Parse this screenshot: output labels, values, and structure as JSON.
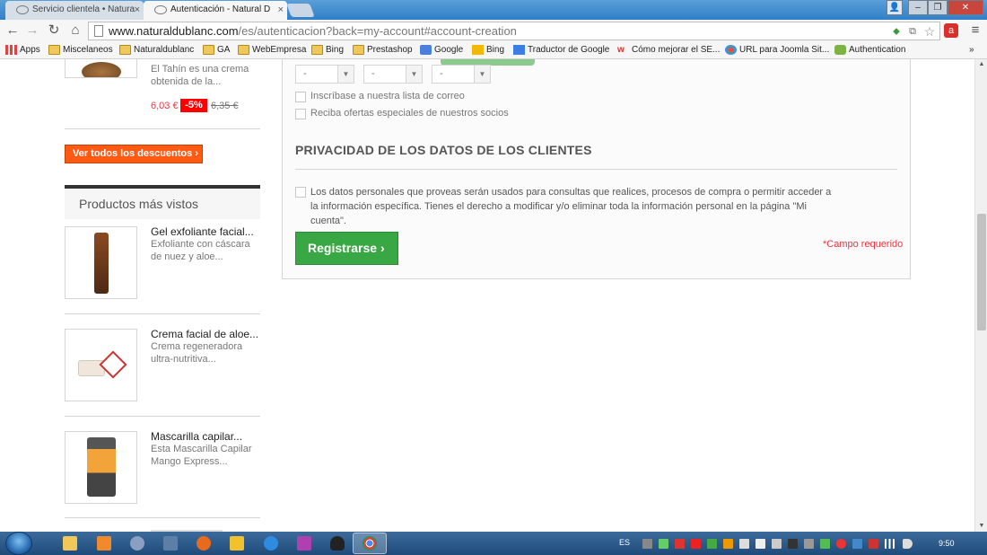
{
  "browser": {
    "tabs": [
      {
        "title": "Servicio clientela • Natura",
        "active": false
      },
      {
        "title": "Autenticación - Natural D",
        "active": true
      }
    ],
    "url_host": "www.naturaldublanc.com",
    "url_path": "/es/autenticacion?back=my-account#account-creation",
    "bookmarks": [
      {
        "label": "Apps",
        "icon": "apps-grid-icon"
      },
      {
        "label": "Miscelaneos",
        "icon": "folder-icon"
      },
      {
        "label": "Naturaldublanc",
        "icon": "folder-icon"
      },
      {
        "label": "GA",
        "icon": "folder-icon"
      },
      {
        "label": "WebEmpresa",
        "icon": "folder-icon"
      },
      {
        "label": "Bing",
        "icon": "folder-icon"
      },
      {
        "label": "Prestashop",
        "icon": "folder-icon"
      },
      {
        "label": "Google",
        "icon": "google-icon"
      },
      {
        "label": "Bing",
        "icon": "bing-icon"
      },
      {
        "label": "Traductor de Google",
        "icon": "translate-icon"
      },
      {
        "label": "Cómo mejorar el SE...",
        "icon": "w-icon"
      },
      {
        "label": "URL para Joomla Sit...",
        "icon": "joomla-icon"
      },
      {
        "label": "Authentication",
        "icon": "android-icon"
      }
    ],
    "bookmarks_overflow": "»"
  },
  "sidebar": {
    "top_product": {
      "desc": "El Tahín es una crema obtenida de la...",
      "price": "6,03 €",
      "discount": "-5%",
      "old_price": "6,35 €"
    },
    "view_discounts_label": "Ver todos los descuentos",
    "most_viewed_title": "Productos más vistos",
    "products": [
      {
        "name": "Gel exfoliante facial...",
        "desc": "Exfoliante con cáscara de nuez y aloe..."
      },
      {
        "name": "Crema facial de aloe...",
        "desc": "Crema regeneradora ultra-nutritiva..."
      },
      {
        "name": "Mascarilla capilar...",
        "desc": "Esta Mascarilla Capilar Mango Express..."
      }
    ]
  },
  "form": {
    "selects": [
      "-",
      "-",
      "-"
    ],
    "newsletter_label": "Inscríbase a nuestra lista de correo",
    "optin_label": "Reciba ofertas especiales de nuestros socios",
    "privacy_title": "PRIVACIDAD DE LOS DATOS DE LOS CLIENTES",
    "privacy_text": "Los datos personales que proveas serán usados para consultas que realices, procesos de compra o permitir acceder a la información específica. Tienes el derecho a modificar y/o eliminar toda la información personal en la página \"Mi cuenta\".",
    "submit_label": "Registrarse",
    "required_note": "*Campo requerido"
  },
  "taskbar": {
    "language": "ES",
    "clock": "9:50"
  },
  "colors": {
    "price_red": "#f13340",
    "discount_orange": "#ff5a13",
    "register_green": "#3aa745"
  }
}
